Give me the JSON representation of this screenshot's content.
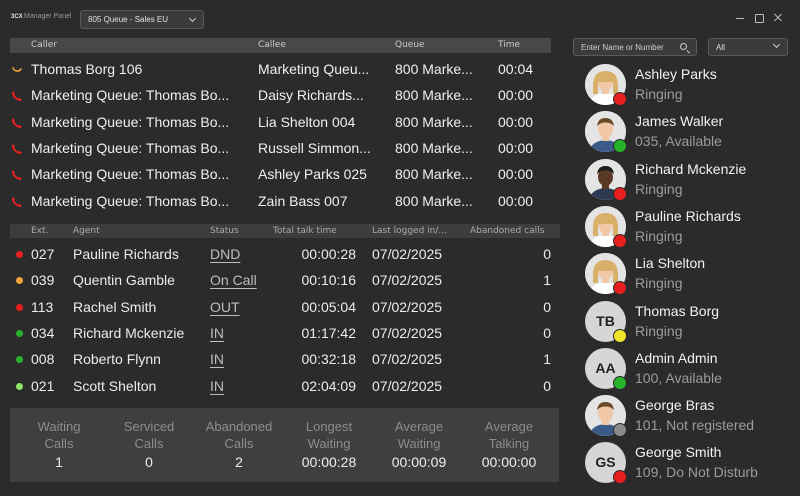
{
  "app": {
    "logo": "3CX",
    "title": "Manager Panel"
  },
  "queue_select": {
    "value": "805 Queue - Sales EU"
  },
  "colors": {
    "red": "#e81f1f",
    "orange": "#f2a23a",
    "green": "#28b22c",
    "light_green": "#8ee36a",
    "yellow": "#f0e52a",
    "gray": "#8a8a8a"
  },
  "calls": {
    "headers": {
      "caller": "Caller",
      "callee": "Callee",
      "queue": "Queue",
      "time": "Time"
    },
    "rows": [
      {
        "icon": "ringing-icon",
        "caller": "Thomas Borg 106",
        "callee": "Marketing Queu...",
        "queue": "800 Marke...",
        "time": "00:04"
      },
      {
        "icon": "phone-icon",
        "caller": "Marketing Queue: Thomas Bo...",
        "callee": "Daisy Richards...",
        "queue": "800 Marke...",
        "time": "00:00"
      },
      {
        "icon": "phone-icon",
        "caller": "Marketing Queue: Thomas Bo...",
        "callee": "Lia Shelton 004",
        "queue": "800 Marke...",
        "time": "00:00"
      },
      {
        "icon": "phone-icon",
        "caller": "Marketing Queue: Thomas Bo...",
        "callee": "Russell Simmon...",
        "queue": "800 Marke...",
        "time": "00:00"
      },
      {
        "icon": "phone-icon",
        "caller": "Marketing Queue: Thomas Bo...",
        "callee": "Ashley Parks 025",
        "queue": "800 Marke...",
        "time": "00:00"
      },
      {
        "icon": "phone-icon",
        "caller": "Marketing Queue: Thomas Bo...",
        "callee": "Zain Bass 007",
        "queue": "800 Marke...",
        "time": "00:00"
      }
    ]
  },
  "agents": {
    "headers": {
      "ext": "Ext.",
      "agent": "Agent",
      "status": "Status",
      "talk": "Total talk time",
      "logged": "Last logged in/...",
      "abandoned": "Abandoned calls"
    },
    "rows": [
      {
        "dot": "red",
        "ext": "027",
        "agent": "Pauline Richards",
        "status": "DND",
        "talk": "00:00:28",
        "logged": "07/02/2025",
        "abandoned": "0"
      },
      {
        "dot": "orange",
        "ext": "039",
        "agent": "Quentin Gamble",
        "status": "On Call",
        "talk": "00:10:16",
        "logged": "07/02/2025",
        "abandoned": "1"
      },
      {
        "dot": "red",
        "ext": "113",
        "agent": "Rachel Smith",
        "status": "OUT",
        "talk": "00:05:04",
        "logged": "07/02/2025",
        "abandoned": "0"
      },
      {
        "dot": "green",
        "ext": "034",
        "agent": "Richard Mckenzie",
        "status": "IN",
        "talk": "01:17:42",
        "logged": "07/02/2025",
        "abandoned": "0"
      },
      {
        "dot": "green",
        "ext": "008",
        "agent": "Roberto Flynn",
        "status": "IN",
        "talk": "00:32:18",
        "logged": "07/02/2025",
        "abandoned": "1"
      },
      {
        "dot": "light_green",
        "ext": "021",
        "agent": "Scott Shelton",
        "status": "IN",
        "talk": "02:04:09",
        "logged": "07/02/2025",
        "abandoned": "0"
      }
    ]
  },
  "stats": [
    {
      "label1": "Waiting",
      "label2": "Calls",
      "value": "1"
    },
    {
      "label1": "Serviced",
      "label2": "Calls",
      "value": "0"
    },
    {
      "label1": "Abandoned",
      "label2": "Calls",
      "value": "2"
    },
    {
      "label1": "Longest",
      "label2": "Waiting",
      "value": "00:00:28"
    },
    {
      "label1": "Average",
      "label2": "Waiting",
      "value": "00:00:09"
    },
    {
      "label1": "Average",
      "label2": "Talking",
      "value": "00:00:00"
    }
  ],
  "search": {
    "placeholder": "Enter Name or Number"
  },
  "filter": {
    "value": "All"
  },
  "contacts": [
    {
      "name": "Ashley Parks",
      "status": "Ringing",
      "presence": "red",
      "avatar": "photo-female",
      "initials": ""
    },
    {
      "name": "James Walker",
      "status": "035, Available",
      "presence": "green",
      "avatar": "photo-male",
      "initials": ""
    },
    {
      "name": "Richard Mckenzie",
      "status": "Ringing",
      "presence": "red",
      "avatar": "photo-male-dark",
      "initials": ""
    },
    {
      "name": "Pauline Richards",
      "status": "Ringing",
      "presence": "red",
      "avatar": "photo-female",
      "initials": ""
    },
    {
      "name": "Lia Shelton",
      "status": "Ringing",
      "presence": "red",
      "avatar": "photo-female",
      "initials": ""
    },
    {
      "name": "Thomas Borg",
      "status": "Ringing",
      "presence": "yellow",
      "avatar": "initials",
      "initials": "TB"
    },
    {
      "name": "Admin Admin",
      "status": "100, Available",
      "presence": "green",
      "avatar": "initials",
      "initials": "AA"
    },
    {
      "name": "George Bras",
      "status": "101, Not registered",
      "presence": "gray",
      "avatar": "photo-male",
      "initials": ""
    },
    {
      "name": "George Smith",
      "status": "109, Do Not Disturb",
      "presence": "red",
      "avatar": "initials",
      "initials": "GS"
    }
  ]
}
